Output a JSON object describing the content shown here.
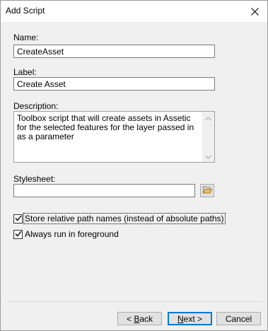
{
  "window": {
    "title": "Add Script"
  },
  "form": {
    "name_label": "Name:",
    "name_value": "CreateAsset",
    "label_label": "Label:",
    "label_value": "Create Asset",
    "description_label": "Description:",
    "description_value": "Toolbox script that will create assets in Assetic for the selected features for the layer passed in as a parameter",
    "stylesheet_label": "Stylesheet:",
    "stylesheet_value": ""
  },
  "options": {
    "relative_paths_label": "Store relative path names (instead of absolute paths)",
    "relative_paths_checked": true,
    "foreground_label": "Always run in foreground",
    "foreground_checked": true
  },
  "buttons": {
    "back_prefix": "< ",
    "back_mnemonic": "B",
    "back_rest": "ack",
    "next_mnemonic": "N",
    "next_rest": "ext >",
    "cancel_label": "Cancel"
  },
  "icons": {
    "close": "close-icon",
    "browse": "folder-open-icon",
    "check": "checkmark-icon",
    "scroll_up": "chevron-up-icon",
    "scroll_down": "chevron-down-icon"
  },
  "colors": {
    "window_bg": "#f0f0f0",
    "default_button_border": "#0078d7",
    "folder_icon": "#e8c15c"
  }
}
